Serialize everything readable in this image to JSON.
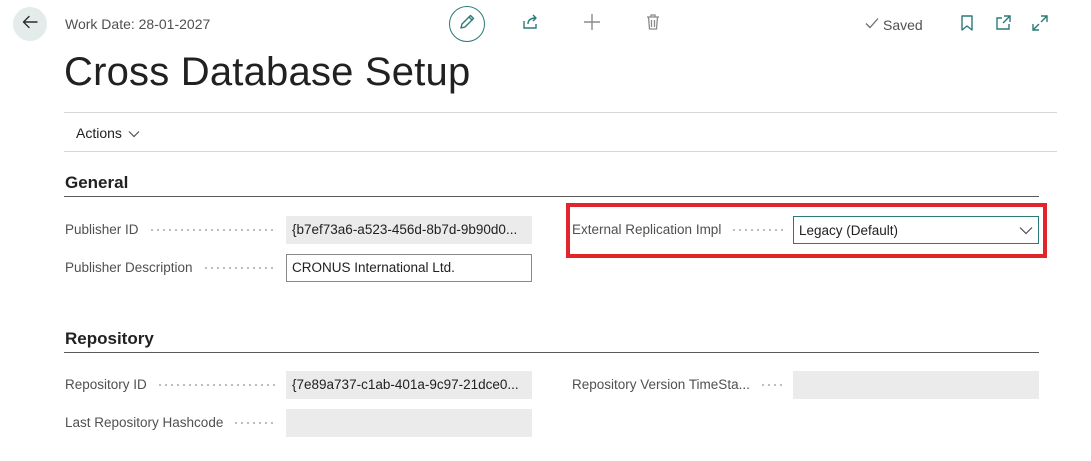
{
  "header": {
    "work_date": "Work Date: 28-01-2027",
    "saved_label": "Saved"
  },
  "icons": {
    "back": "back-arrow-icon",
    "edit": "pencil-icon",
    "share": "share-icon",
    "new": "plus-icon",
    "delete": "trash-icon",
    "saved": "checkmark-icon",
    "bookmark": "bookmark-icon",
    "open_new_window": "open-new-window-icon",
    "expand": "expand-icon",
    "actions_chevron": "chevron-down-icon",
    "dropdown_chevron": "chevron-down-icon"
  },
  "page": {
    "title": "Cross Database Setup"
  },
  "action_bar": {
    "actions_label": "Actions"
  },
  "general": {
    "title": "General",
    "publisher_id_label": "Publisher ID",
    "publisher_id_value": "{b7ef73a6-a523-456d-8b7d-9b90d0...",
    "publisher_description_label": "Publisher Description",
    "publisher_description_value": "CRONUS International Ltd.",
    "external_replication_label": "External Replication Impl",
    "external_replication_value": "Legacy (Default)"
  },
  "repository": {
    "title": "Repository",
    "repository_id_label": "Repository ID",
    "repository_id_value": "{7e89a737-c1ab-401a-9c97-21dce0...",
    "last_hashcode_label": "Last Repository Hashcode",
    "last_hashcode_value": "",
    "version_timestamp_label": "Repository Version TimeSta...",
    "version_timestamp_value": ""
  },
  "colors": {
    "accent": "#2b7a78",
    "highlight": "#e0262c",
    "readonly_bg": "#ebebeb"
  }
}
